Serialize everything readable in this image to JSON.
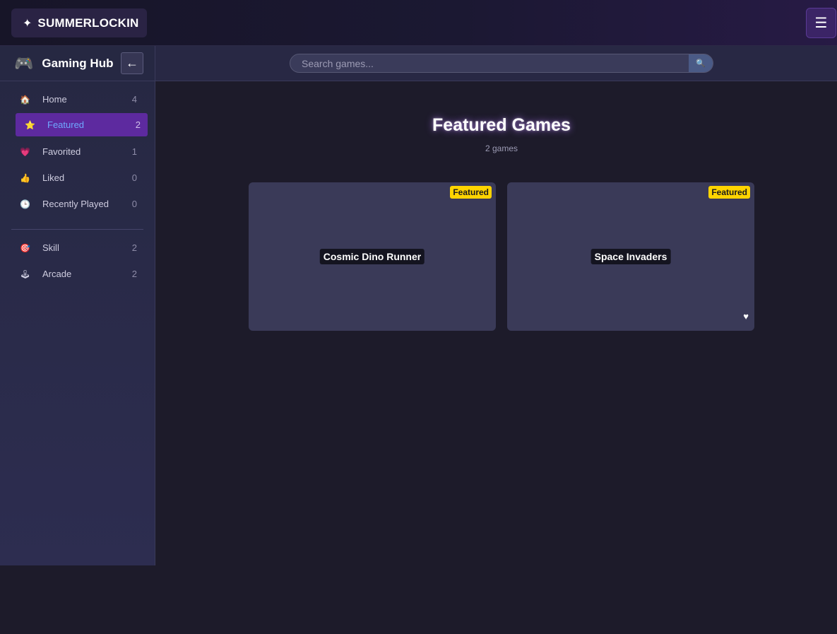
{
  "topbar": {
    "brand_icon": "sparkle-icon",
    "brand_text": "SUMMERLOCKIN",
    "menu_icon": "hamburger-menu-icon",
    "menu_glyph": "☰"
  },
  "sidebar": {
    "hub_icon": "gamepad-icon",
    "hub_title": "Gaming Hub",
    "collapse_glyph": "←",
    "items": [
      {
        "label": "Home",
        "count": "4",
        "icon": "house-icon",
        "glyph": "🏠",
        "active": false
      },
      {
        "label": "Featured",
        "count": "2",
        "icon": "star-icon",
        "glyph": "⭐",
        "active": true
      },
      {
        "label": "Favorited",
        "count": "1",
        "icon": "heart-icon",
        "glyph": "💗",
        "active": false
      },
      {
        "label": "Liked",
        "count": "0",
        "icon": "thumbs-up-icon",
        "glyph": "👍",
        "active": false
      },
      {
        "label": "Recently Played",
        "count": "0",
        "icon": "clock-icon",
        "glyph": "🕒",
        "active": false
      }
    ],
    "categories": [
      {
        "label": "Skill",
        "count": "2",
        "icon": "target-icon",
        "glyph": "🎯"
      },
      {
        "label": "Arcade",
        "count": "2",
        "icon": "joystick-icon",
        "glyph": "🕹"
      }
    ]
  },
  "search": {
    "placeholder": "Search games...",
    "value": "",
    "button_icon": "magnifier-icon",
    "button_glyph": "🔍"
  },
  "main": {
    "title": "Featured Games",
    "subtitle": "2 games",
    "games": [
      {
        "title": "Cosmic Dino Runner",
        "badge": "Featured",
        "favorited": false
      },
      {
        "title": "Space Invaders",
        "badge": "Featured",
        "favorited": true,
        "fav_glyph": "♥"
      }
    ]
  },
  "colors": {
    "accent_purple": "#5d2a9f",
    "active_text": "#6fa8ff",
    "badge_yellow": "#ffd400",
    "background": "#1d1b2a",
    "card": "#3a3a58"
  }
}
